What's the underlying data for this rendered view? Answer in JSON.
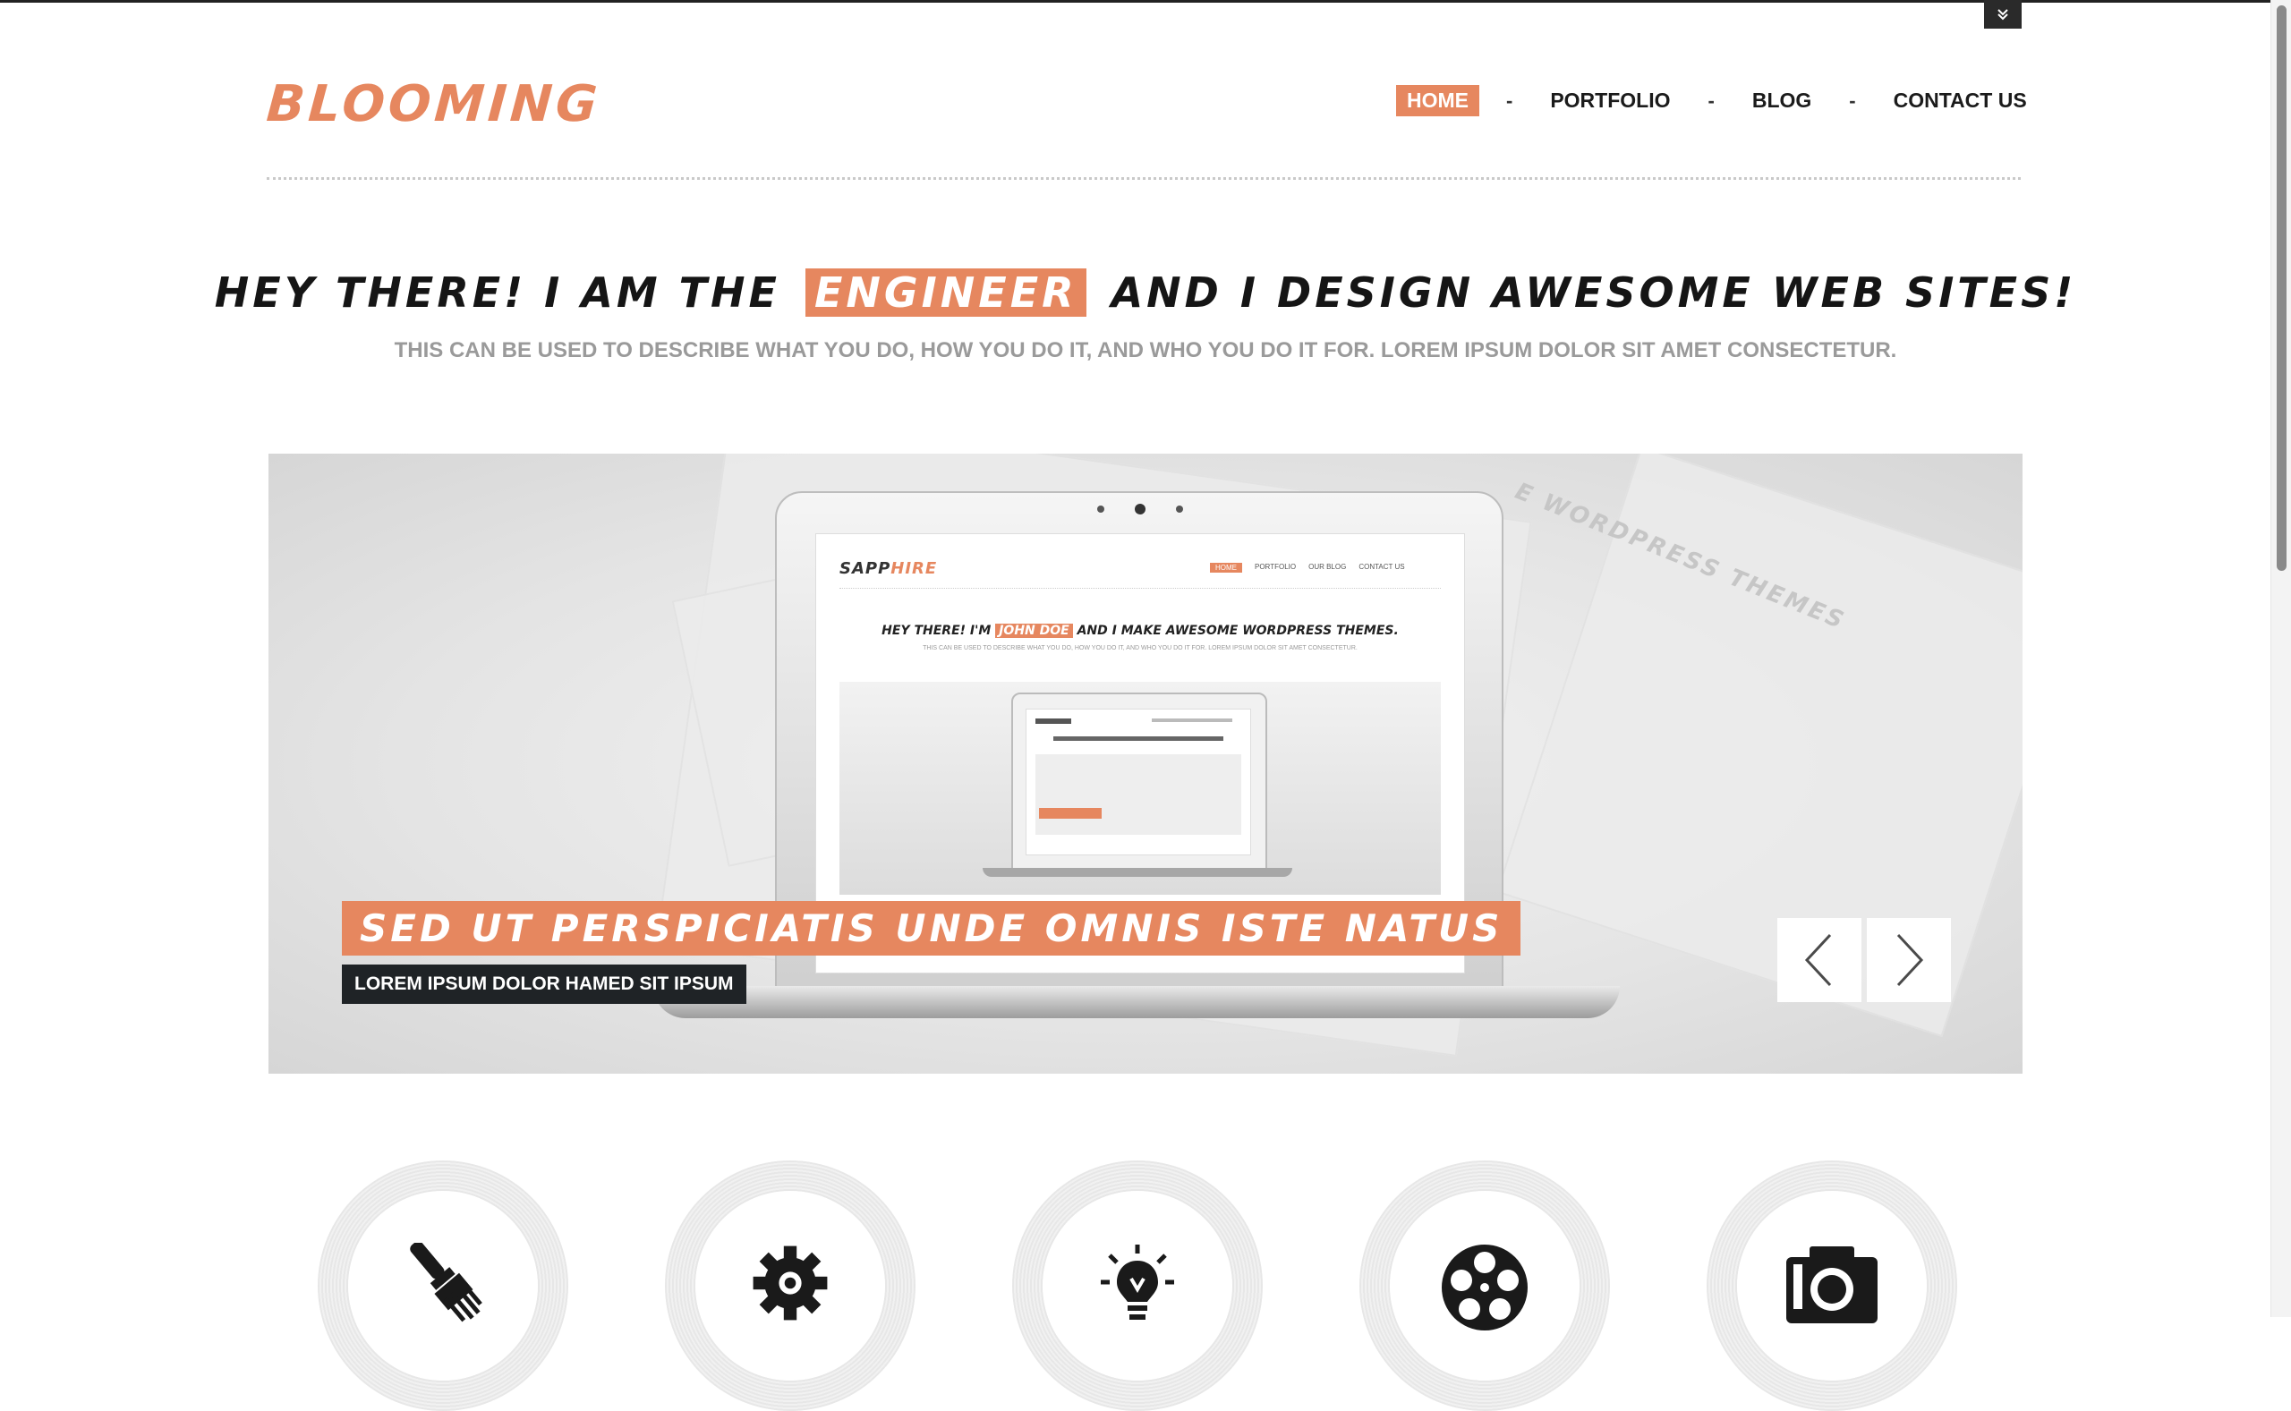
{
  "brand": {
    "logo": "BLOOMING",
    "accent_color": "#e6875f"
  },
  "nav": {
    "items": [
      {
        "label": "HOME",
        "active": true
      },
      {
        "label": "PORTFOLIO",
        "active": false
      },
      {
        "label": "BLOG",
        "active": false
      },
      {
        "label": "CONTACT US",
        "active": false
      }
    ],
    "separator": "-"
  },
  "hero": {
    "headline_before": "HEY THERE! I AM THE",
    "headline_highlight": "ENGINEER",
    "headline_after": "AND I DESIGN AWESOME WEB SITES!",
    "subheadline": "THIS CAN BE USED TO DESCRIBE WHAT YOU DO, HOW YOU DO IT, AND WHO YOU DO IT FOR. LOREM IPSUM DOLOR SIT AMET CONSECTETUR."
  },
  "slider": {
    "caption_title": "SED UT PERSPICIATIS UNDE OMNIS ISTE NATUS",
    "caption_subtitle": "LOREM IPSUM DOLOR HAMED SIT IPSUM",
    "background_text": "E WORDPRESS THEMES",
    "mock_site": {
      "logo_part1": "SAPP",
      "logo_part2": "HIRE",
      "nav": [
        "HOME",
        "PORTFOLIO",
        "OUR BLOG",
        "CONTACT US"
      ],
      "headline_before": "HEY THERE! I'M",
      "headline_highlight": "JOHN DOE",
      "headline_after": "AND I MAKE AWESOME WORDPRESS THEMES.",
      "subheadline": "THIS CAN BE USED TO DESCRIBE WHAT YOU DO, HOW YOU DO IT, AND WHO YOU DO IT FOR. LOREM IPSUM DOLOR SIT AMET CONSECTETUR."
    }
  },
  "services": [
    {
      "icon": "paintbrush-icon"
    },
    {
      "icon": "gear-icon"
    },
    {
      "icon": "lightbulb-icon"
    },
    {
      "icon": "film-reel-icon"
    },
    {
      "icon": "camera-icon"
    }
  ]
}
